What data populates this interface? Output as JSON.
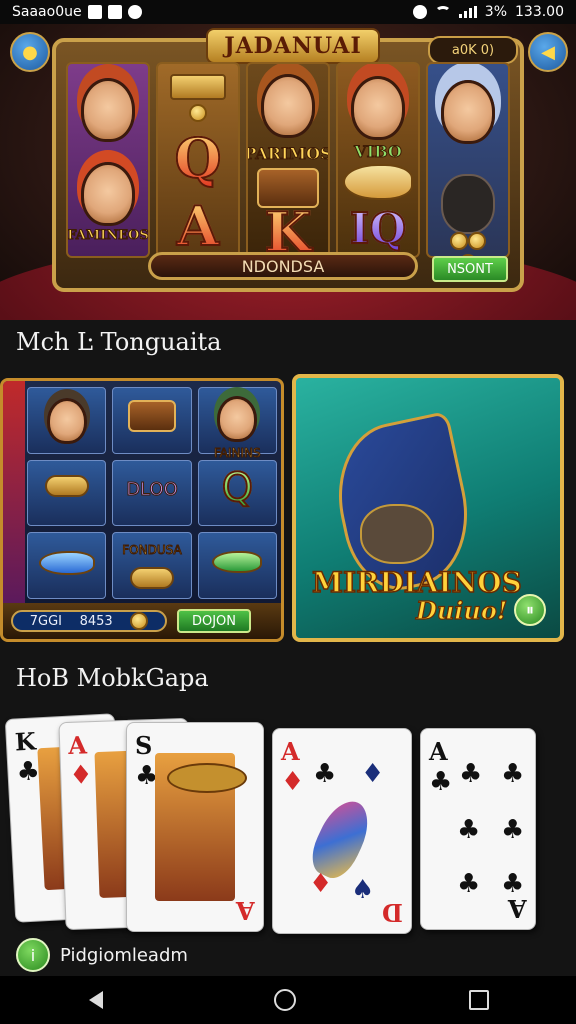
{
  "status_bar": {
    "carrier": "Saaao0ue",
    "battery": "3%",
    "time": "133.00"
  },
  "hero": {
    "title": "JADANUAI",
    "credit": "a0K 0)",
    "reel_labels": [
      "FAMINEOS",
      "PARIMOS",
      "VIBO"
    ],
    "symbols": [
      "Q",
      "A",
      "K",
      "IQ"
    ],
    "bottom_label": "NDONDSA",
    "button": "NSONT"
  },
  "section1": {
    "title": "Mch Ŀ Tonguaita"
  },
  "tiles": [
    {
      "labels": [
        "DLOO",
        "FAININS",
        "FONDUSA"
      ],
      "symbol": "Q",
      "pill_left": "7GGI",
      "pill_right": "8453",
      "button": "DOJON"
    },
    {
      "title": "MIRDIAINOS",
      "subtitle": "Duiuo!"
    }
  ],
  "section2": {
    "title": "HoB MobkGapa"
  },
  "cards": [
    {
      "rank": "K",
      "suit": "♣"
    },
    {
      "rank": "A",
      "suit": "♦"
    },
    {
      "rank": "S",
      "suit": "♣",
      "corner": "A"
    },
    {
      "rank": "A",
      "suit": "♦",
      "corner": "D"
    },
    {
      "rank": "A",
      "suit": "♣",
      "corner": "A"
    }
  ],
  "footer": {
    "label": "Pidgiomleadm"
  }
}
